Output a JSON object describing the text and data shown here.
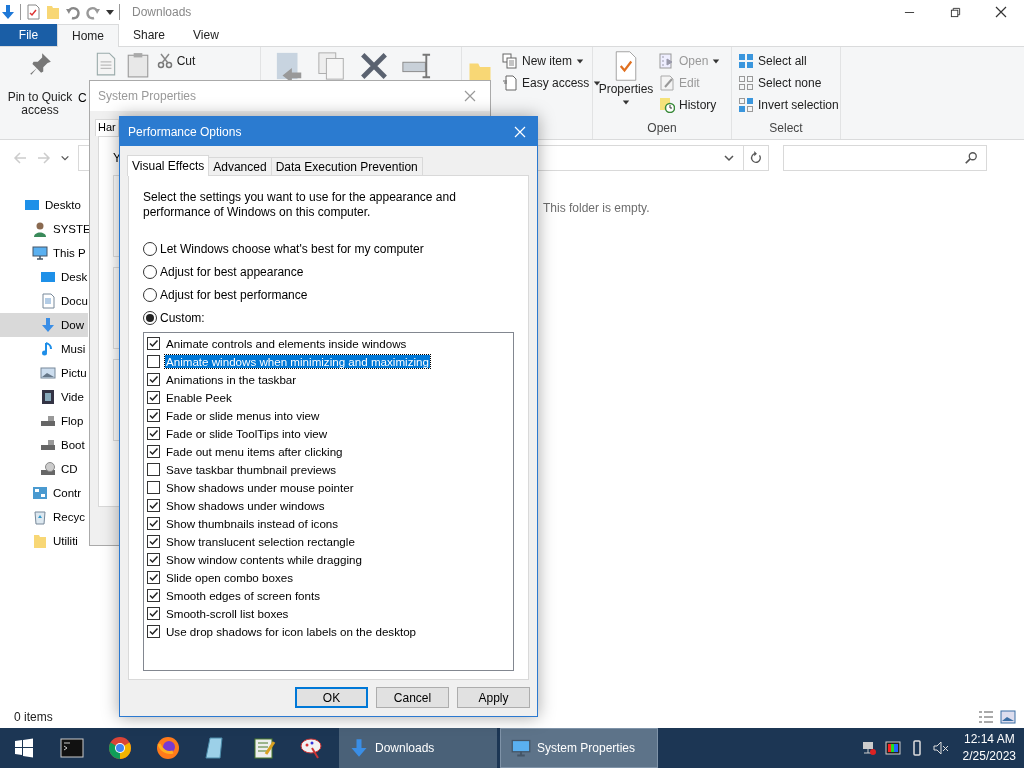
{
  "explorer": {
    "title": "Downloads",
    "ribbon_tabs": [
      {
        "label": "File",
        "kind": "file",
        "selected": false
      },
      {
        "label": "Home",
        "kind": "tab",
        "selected": true
      },
      {
        "label": "Share",
        "kind": "tab",
        "selected": false
      },
      {
        "label": "View",
        "kind": "tab",
        "selected": false
      }
    ],
    "ribbon": {
      "pin": "Pin to Quick access",
      "copy": "C",
      "cut": "Cut",
      "new_item": "New item",
      "easy_access": "Easy access",
      "properties": "Properties",
      "open": "Open",
      "edit": "Edit",
      "history": "History",
      "open_group": "Open",
      "select_all": "Select all",
      "select_none": "Select none",
      "invert_selection": "Invert selection",
      "select_group": "Select"
    },
    "nav": [
      {
        "label": "Deskto",
        "kind": "desktop",
        "selected": false,
        "children": [
          {
            "label": "SYSTE",
            "kind": "user",
            "selected": false
          },
          {
            "label": "This P",
            "kind": "pc",
            "selected": false,
            "children": [
              {
                "label": "Desk",
                "kind": "desktop",
                "selected": false
              },
              {
                "label": "Docu",
                "kind": "document",
                "selected": false
              },
              {
                "label": "Dow",
                "kind": "download",
                "selected": true
              },
              {
                "label": "Musi",
                "kind": "music",
                "selected": false
              },
              {
                "label": "Pictu",
                "kind": "picture",
                "selected": false
              },
              {
                "label": "Vide",
                "kind": "video",
                "selected": false
              },
              {
                "label": "Flop",
                "kind": "drive",
                "selected": false
              },
              {
                "label": "Boot",
                "kind": "drive",
                "selected": false
              },
              {
                "label": "CD",
                "kind": "cd",
                "selected": false
              }
            ]
          },
          {
            "label": "Contr",
            "kind": "control",
            "selected": false
          },
          {
            "label": "Recyc",
            "kind": "recycle",
            "selected": false
          },
          {
            "label": "Utiliti",
            "kind": "folder",
            "selected": false
          }
        ]
      }
    ],
    "empty_message": "This folder is empty.",
    "status": "0 items"
  },
  "system_properties": {
    "title": "System Properties",
    "tab": "Har",
    "label": "Y"
  },
  "performance_options": {
    "title": "Performance Options",
    "tabs": [
      {
        "label": "Visual Effects",
        "selected": true
      },
      {
        "label": "Advanced",
        "selected": false
      },
      {
        "label": "Data Execution Prevention",
        "selected": false
      }
    ],
    "description": "Select the settings you want to use for the appearance and performance of Windows on this computer.",
    "modes": [
      {
        "label": "Let Windows choose what's best for my computer",
        "selected": false
      },
      {
        "label": "Adjust for best appearance",
        "selected": false
      },
      {
        "label": "Adjust for best performance",
        "selected": false
      },
      {
        "label": "Custom:",
        "selected": true
      }
    ],
    "effects": [
      {
        "label": "Animate controls and elements inside windows",
        "checked": true,
        "selected": false
      },
      {
        "label": "Animate windows when minimizing and maximizing",
        "checked": false,
        "selected": true
      },
      {
        "label": "Animations in the taskbar",
        "checked": true,
        "selected": false
      },
      {
        "label": "Enable Peek",
        "checked": true,
        "selected": false
      },
      {
        "label": "Fade or slide menus into view",
        "checked": true,
        "selected": false
      },
      {
        "label": "Fade or slide ToolTips into view",
        "checked": true,
        "selected": false
      },
      {
        "label": "Fade out menu items after clicking",
        "checked": true,
        "selected": false
      },
      {
        "label": "Save taskbar thumbnail previews",
        "checked": false,
        "selected": false
      },
      {
        "label": "Show shadows under mouse pointer",
        "checked": false,
        "selected": false
      },
      {
        "label": "Show shadows under windows",
        "checked": true,
        "selected": false
      },
      {
        "label": "Show thumbnails instead of icons",
        "checked": true,
        "selected": false
      },
      {
        "label": "Show translucent selection rectangle",
        "checked": true,
        "selected": false
      },
      {
        "label": "Show window contents while dragging",
        "checked": true,
        "selected": false
      },
      {
        "label": "Slide open combo boxes",
        "checked": true,
        "selected": false
      },
      {
        "label": "Smooth edges of screen fonts",
        "checked": true,
        "selected": false
      },
      {
        "label": "Smooth-scroll list boxes",
        "checked": true,
        "selected": false
      },
      {
        "label": "Use drop shadows for icon labels on the desktop",
        "checked": true,
        "selected": false
      }
    ],
    "buttons": [
      {
        "label": "OK",
        "kind": "default"
      },
      {
        "label": "Cancel",
        "kind": "normal"
      },
      {
        "label": "Apply",
        "kind": "normal"
      }
    ]
  },
  "taskbar": {
    "windows": [
      {
        "label": "Downloads",
        "kind": "download",
        "selected": false
      },
      {
        "label": "System Properties",
        "kind": "pc",
        "selected": true
      }
    ],
    "time": "12:14 AM",
    "date": "2/25/2023"
  }
}
